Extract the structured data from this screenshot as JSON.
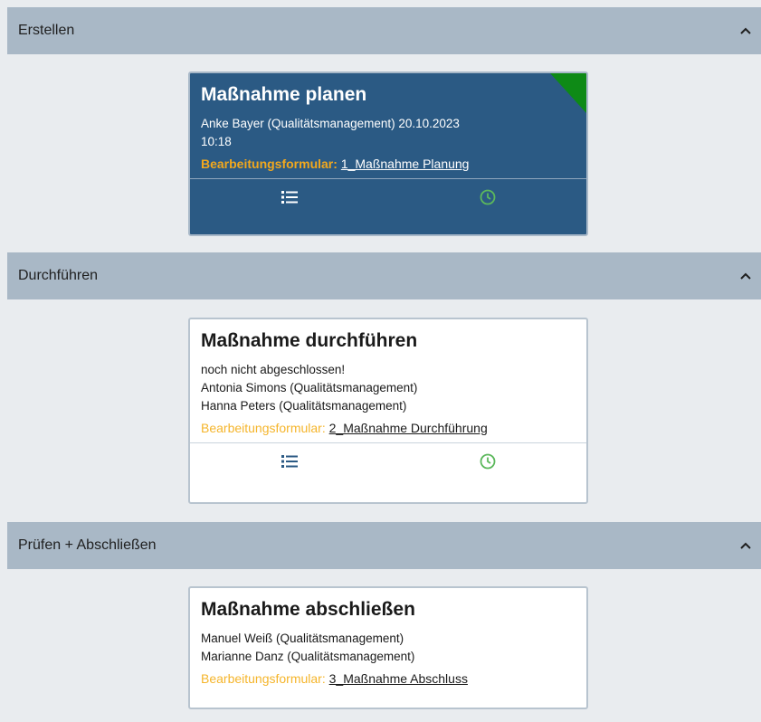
{
  "sections": [
    {
      "header": "Erstellen",
      "card": {
        "title": "Maßnahme planen",
        "lines": [
          "Anke Bayer (Qualitätsmanagement) 20.10.2023",
          "10:18"
        ],
        "form_label": "Bearbeitungsformular:",
        "form_link": "1_Maßnahme Planung",
        "status_corner_color": "#0e8a16"
      }
    },
    {
      "header": "Durchführen",
      "card": {
        "title": "Maßnahme durchführen",
        "lines": [
          "noch nicht abgeschlossen!",
          "Antonia Simons (Qualitätsmanagement)",
          "Hanna Peters (Qualitätsmanagement)"
        ],
        "form_label": "Bearbeitungsformular:",
        "form_link": "2_Maßnahme Durchführung"
      }
    },
    {
      "header": "Prüfen + Abschließen",
      "card": {
        "title": "Maßnahme abschließen",
        "lines": [
          "Manuel Weiß (Qualitätsmanagement)",
          "Marianne Danz (Qualitätsmanagement)"
        ],
        "form_label": "Bearbeitungsformular:",
        "form_link": "3_Maßnahme Abschluss"
      }
    }
  ],
  "icons": {
    "collapse": "chevron-up-icon",
    "list": "list-icon",
    "history": "clock-icon"
  },
  "colors": {
    "header_bg": "#a9b8c6",
    "active_card_bg": "#2b5a84",
    "form_label": "#f2a81d",
    "clock_green": "#5cb85c"
  }
}
